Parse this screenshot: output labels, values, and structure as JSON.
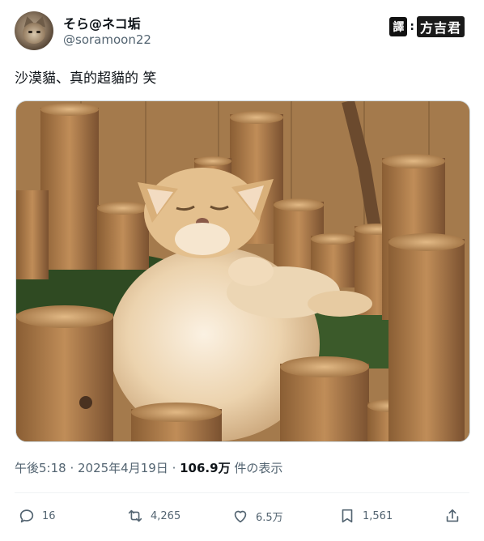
{
  "author": {
    "display_name": "そら@ネコ垢",
    "handle": "@soramoon22"
  },
  "watermark": {
    "badge": "譯",
    "separator": ":",
    "name": "方吉君"
  },
  "tweet": {
    "text": "沙漠貓、真的超貓的 笑"
  },
  "media": {
    "icon": "photo-sand-cat-sleeping"
  },
  "meta": {
    "time": "午後5:18",
    "sep1": " · ",
    "date": "2025年4月19日",
    "sep2": " · ",
    "views": "106.9万",
    "views_suffix": " 件の表示"
  },
  "actions": {
    "reply_count": "16",
    "retweet_count": "4,265",
    "like_count": "6.5万",
    "bookmark_count": "1,561"
  },
  "colors": {
    "text_primary": "#0f1419",
    "text_secondary": "#536471",
    "divider": "#eff3f4"
  }
}
